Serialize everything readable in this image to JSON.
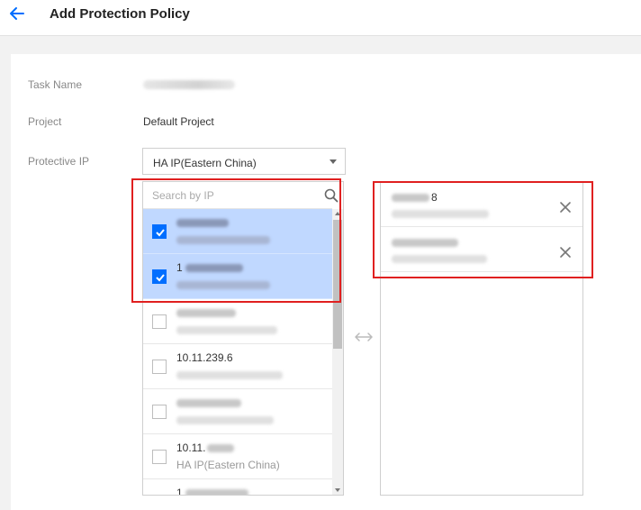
{
  "header": {
    "title": "Add Protection Policy",
    "back_icon": "arrow-left-icon",
    "accent": "#006eff"
  },
  "form": {
    "task_name": {
      "label": "Task Name",
      "value": ""
    },
    "project": {
      "label": "Project",
      "value": "Default Project"
    },
    "protective_ip": {
      "label": "Protective IP",
      "selected": "HA IP(Eastern China)"
    }
  },
  "left_list": {
    "search_placeholder": "Search by IP",
    "items": [
      {
        "ip": "",
        "region": "",
        "checked": true
      },
      {
        "ip": "1",
        "region": "",
        "checked": true
      },
      {
        "ip": "",
        "region": "",
        "checked": false
      },
      {
        "ip": "10.11.239.6",
        "region": "",
        "checked": false
      },
      {
        "ip": "",
        "region": "",
        "checked": false
      },
      {
        "ip": "10.11.",
        "region": "HA IP(Eastern China)",
        "checked": false
      },
      {
        "ip": "1",
        "region": "",
        "checked": false
      }
    ]
  },
  "right_list": {
    "items": [
      {
        "ip": "8",
        "region": ""
      },
      {
        "ip": "",
        "region": ""
      }
    ]
  },
  "colors": {
    "highlight": "#e02020",
    "selected_row": "#c0d8ff",
    "checkbox": "#006eff"
  }
}
